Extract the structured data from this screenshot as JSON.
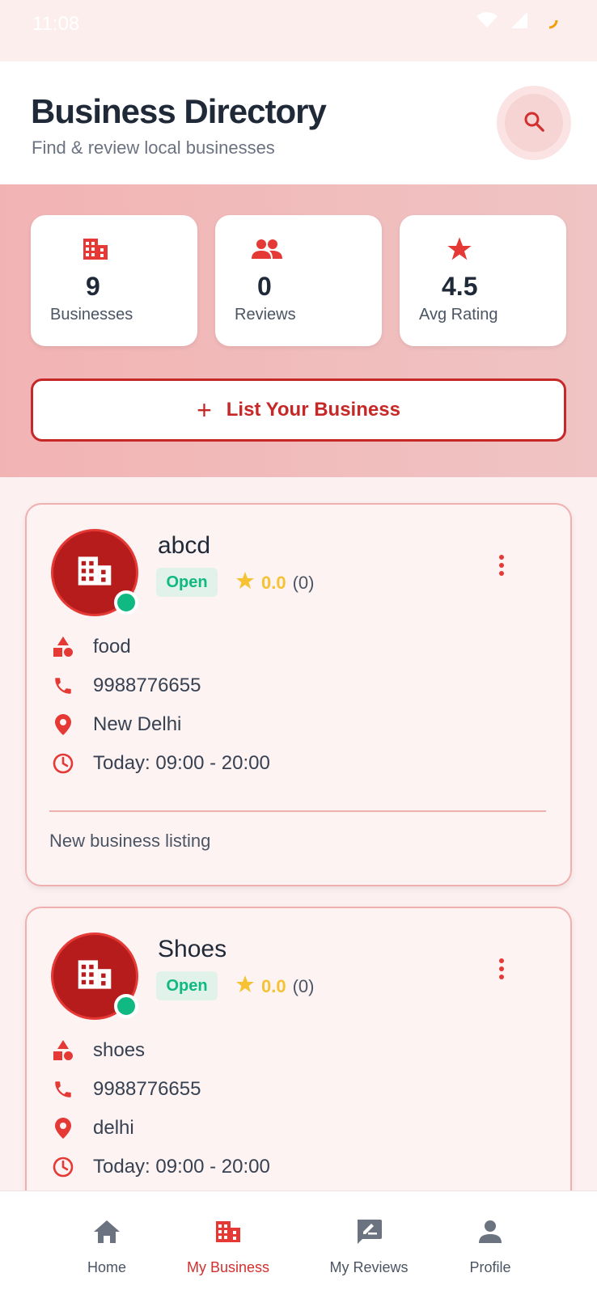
{
  "status_bar": {
    "time": "11:08"
  },
  "header": {
    "title": "Business Directory",
    "subtitle": "Find & review local businesses",
    "search_icon": "search-icon"
  },
  "stats": [
    {
      "icon": "building-icon",
      "value": "9",
      "label": "Businesses"
    },
    {
      "icon": "people-icon",
      "value": "0",
      "label": "Reviews"
    },
    {
      "icon": "star-icon",
      "value": "4.5",
      "label": "Avg Rating"
    }
  ],
  "list_button": {
    "plus": "+",
    "label": "List Your Business"
  },
  "businesses": [
    {
      "name": "abcd",
      "status": "Open",
      "rating": "0.0",
      "review_count": "(0)",
      "category": "food",
      "phone": "9988776655",
      "location": "New Delhi",
      "hours": "Today: 09:00 - 20:00",
      "description": "New business listing"
    },
    {
      "name": "Shoes",
      "status": "Open",
      "rating": "0.0",
      "review_count": "(0)",
      "category": "shoes",
      "phone": "9988776655",
      "location": "delhi",
      "hours": "Today: 09:00 - 20:00"
    }
  ],
  "nav": [
    {
      "label": "Home",
      "icon": "home-icon",
      "active": false
    },
    {
      "label": "My Business",
      "icon": "building-icon",
      "active": true
    },
    {
      "label": "My Reviews",
      "icon": "rate-review-icon",
      "active": false
    },
    {
      "label": "Profile",
      "icon": "person-icon",
      "active": false
    }
  ],
  "colors": {
    "primary": "#c62828",
    "open_green": "#10b981",
    "star_yellow": "#f6c233"
  }
}
